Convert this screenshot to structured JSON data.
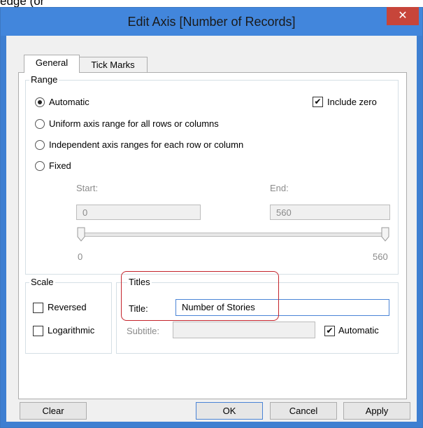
{
  "above_window_text": "edge (or",
  "window": {
    "title": "Edit Axis [Number of Records]",
    "close_glyph": "✕"
  },
  "tabs": [
    {
      "label": "General",
      "selected": true
    },
    {
      "label": "Tick Marks",
      "selected": false
    }
  ],
  "range": {
    "group_label": "Range",
    "options": [
      {
        "label": "Automatic",
        "selected": true
      },
      {
        "label": "Uniform axis range for all rows or columns",
        "selected": false
      },
      {
        "label": "Independent axis ranges for each row or column",
        "selected": false
      },
      {
        "label": "Fixed",
        "selected": false
      }
    ],
    "include_zero_label": "Include zero",
    "include_zero_checked": true,
    "start_label": "Start:",
    "end_label": "End:",
    "start_value": "0",
    "end_value": "560",
    "slider_min_label": "0",
    "slider_max_label": "560"
  },
  "scale": {
    "group_label": "Scale",
    "reversed_label": "Reversed",
    "reversed_checked": false,
    "logarithmic_label": "Logarithmic",
    "logarithmic_checked": false
  },
  "titles": {
    "group_label": "Titles",
    "title_label": "Title:",
    "title_value": "Number of Stories",
    "subtitle_label": "Subtitle:",
    "subtitle_value": "",
    "automatic_label": "Automatic",
    "automatic_checked": true
  },
  "buttons": {
    "clear": "Clear",
    "ok": "OK",
    "cancel": "Cancel",
    "apply": "Apply"
  },
  "colors": {
    "window_frame": "#4286dc",
    "close_button": "#c7453a",
    "annotation_highlight": "#c4232b"
  }
}
